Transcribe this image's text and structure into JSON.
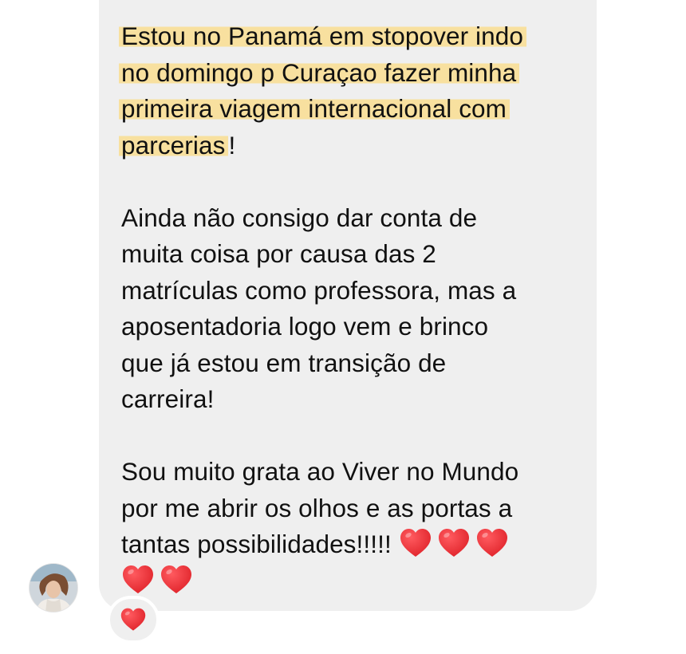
{
  "message": {
    "paragraph1": {
      "line1": "Estou no Panamá em stopover indo",
      "line2": "no domingo p Curaçao fazer minha",
      "line3": "primeira viagem internacional com",
      "line4_highlighted": "parcerias",
      "line4_rest": "!"
    },
    "paragraph2": {
      "line1": "Ainda não consigo dar conta de",
      "line2": "muita coisa por causa das 2",
      "line3": "matrículas como professora, mas a",
      "line4": "aposentadoria logo vem e brinco",
      "line5": "que já estou em transição de",
      "line6": "carreira!"
    },
    "paragraph3": {
      "line1": "Sou muito grata ao Viver no Mundo",
      "line2": "por me abrir os olhos e as portas a",
      "line3": "tantas possibilidades!!!!! "
    },
    "hearts": [
      "red-heart",
      "red-heart",
      "red-heart",
      "red-heart",
      "red-heart"
    ]
  },
  "reaction": {
    "emoji": "red-heart"
  },
  "colors": {
    "bubble": "#efefef",
    "highlight": "#f9de91",
    "heart": "#e0242b"
  }
}
